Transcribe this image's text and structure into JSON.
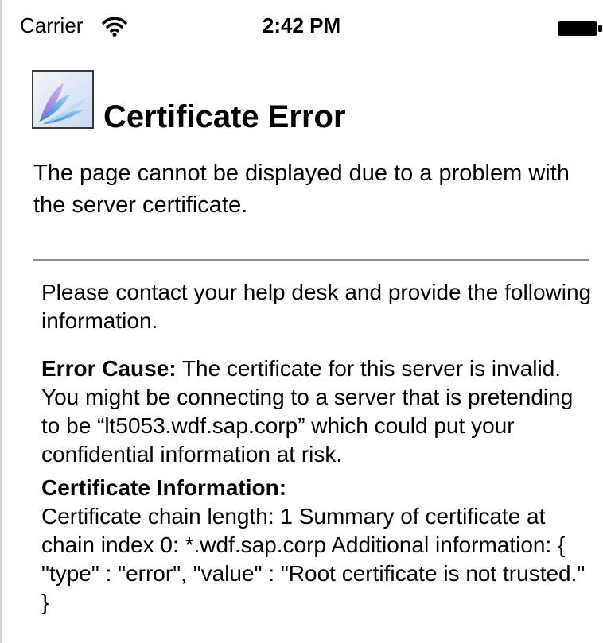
{
  "status_bar": {
    "carrier": "Carrier",
    "time": "2:42 PM",
    "wifi_icon": "wifi-icon",
    "battery_icon": "battery-full-icon"
  },
  "header": {
    "logo_icon": "app-logo-icon",
    "title": "Certificate Error",
    "subtitle": "The page cannot be displayed due to a problem with the server certificate."
  },
  "body": {
    "intro": "Please contact your help desk and provide the following information.",
    "error_cause_label": "Error Cause:",
    "error_cause_text": " The certificate for this server is invalid. You might be connecting to a server that is pretending to be “lt5053.wdf.sap.corp” which could put your confidential information at risk.",
    "certificate_info_label": "Certificate Information:",
    "certificate_info_text": "Certificate chain length: 1 Summary of certificate at chain index 0: *.wdf.sap.corp Additional information: { \"type\" : \"error\", \"value\" : \"Root certificate is not trusted.\" }"
  },
  "colors": {
    "text": "#000000",
    "divider": "#8e8e8e",
    "background": "#ffffff"
  }
}
